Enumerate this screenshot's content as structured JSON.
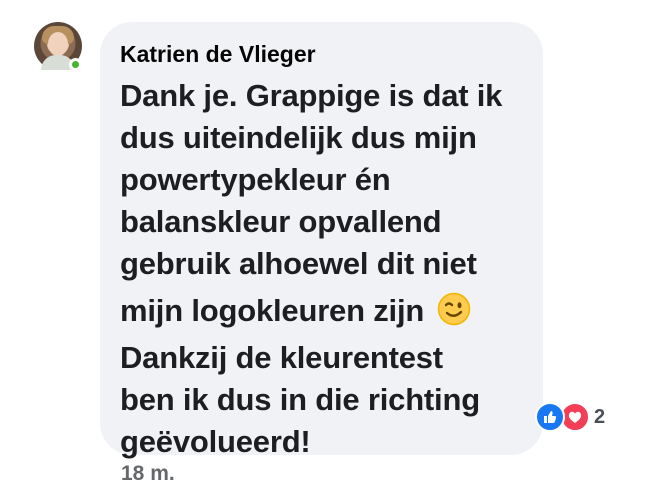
{
  "comment": {
    "author": "Katrien de Vlieger",
    "lines": [
      "Dank je. Grappige is dat ik",
      "dus uiteindelijk dus mijn",
      "powertypekleur én",
      "balanskleur opvallend",
      "gebruik alhoewel dit niet",
      "mijn logokleuren zijn",
      "Dankzij de kleurentest",
      "ben ik dus in die richting",
      "geëvolueerd!"
    ],
    "emoji": "winking-face-icon",
    "timestamp": "18 m.",
    "reaction_count": "2",
    "reaction_icons": [
      "like-icon",
      "love-icon"
    ],
    "online": true
  },
  "colors": {
    "bubble_bg": "#f0f2f5",
    "like_blue": "#1877f2",
    "love_red": "#f33e58",
    "online_green": "#42b72a"
  }
}
